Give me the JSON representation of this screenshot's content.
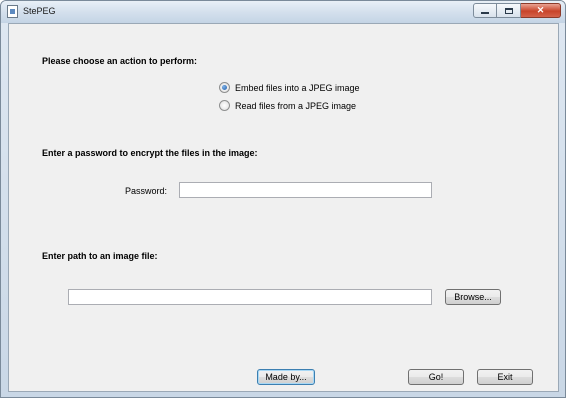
{
  "window": {
    "title": "StePEG"
  },
  "action_section": {
    "heading": "Please choose an action to perform:",
    "options": [
      {
        "label": "Embed files into a JPEG image",
        "checked": true
      },
      {
        "label": "Read files from a JPEG image",
        "checked": false
      }
    ]
  },
  "password_section": {
    "heading": "Enter a password to encrypt the files in the image:",
    "label": "Password:",
    "value": ""
  },
  "image_section": {
    "heading": "Enter path to an image file:",
    "path_value": "",
    "browse_label": "Browse..."
  },
  "footer": {
    "made_by_label": "Made by...",
    "go_label": "Go!",
    "exit_label": "Exit"
  }
}
